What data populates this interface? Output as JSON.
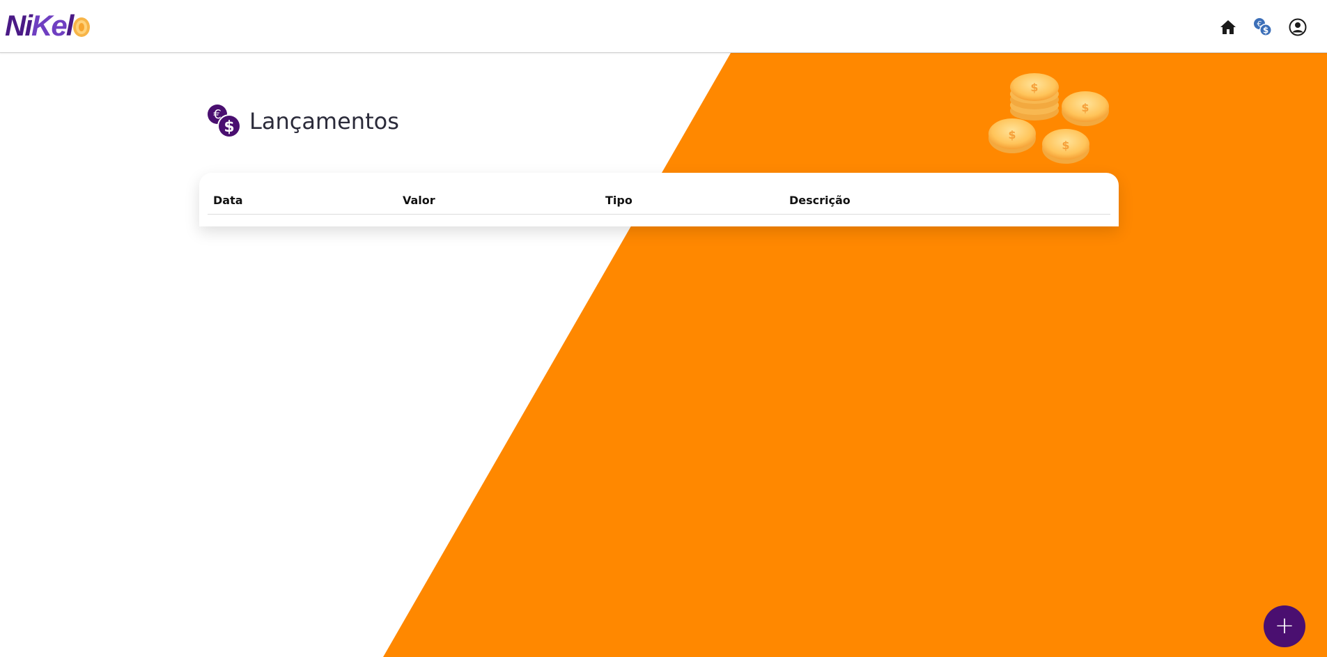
{
  "app": {
    "logo_text_prefix": "Ni",
    "logo_text_middle": "Ke",
    "logo_text_suffix": "l",
    "brand_color": "#4a1a86",
    "accent_color": "#ff8a00"
  },
  "nav": {
    "icons": [
      "home-icon",
      "transactions-icon",
      "profile-icon"
    ]
  },
  "page": {
    "title": "Lançamentos",
    "title_icon": "euro-dollar-coins-icon"
  },
  "table": {
    "columns": [
      "Data",
      "Valor",
      "Tipo",
      "Descrição"
    ],
    "rows": []
  },
  "fab": {
    "label": "+",
    "color": "#4a0f70"
  }
}
